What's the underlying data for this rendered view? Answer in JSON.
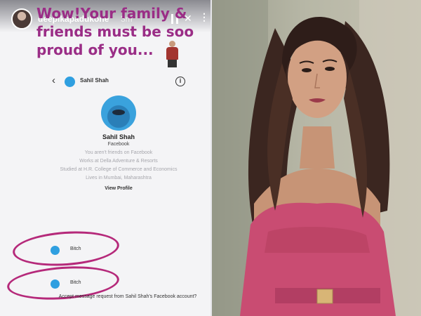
{
  "story": {
    "username": "deepikapadukone",
    "time": "3m",
    "caption": "Wow!Your family & friends must be soo proud of you...",
    "icons": [
      "pause-icon",
      "mute-icon",
      "more-icon",
      "back-icon",
      "info-icon"
    ]
  },
  "profile": {
    "header_name": "Sahil Shah",
    "name": "Sahil Shah",
    "sub": "Facebook",
    "details": [
      "You aren't friends on Facebook",
      "Works at Della Adventure & Resorts",
      "Studied at H.R. College of Commerce and Economics",
      "Lives in Mumbai, Maharashtra"
    ],
    "view_profile": "View Profile"
  },
  "messages": [
    {
      "text": "Bitch"
    },
    {
      "text": "Bitch"
    }
  ],
  "footer_prompt": "Accept message request from Sahil Shah's Facebook account?",
  "colors": {
    "caption": "#9a2d86",
    "circle": "#b5297a",
    "avatar_blue": "#2f9fe0",
    "dress": "#c94c72"
  }
}
